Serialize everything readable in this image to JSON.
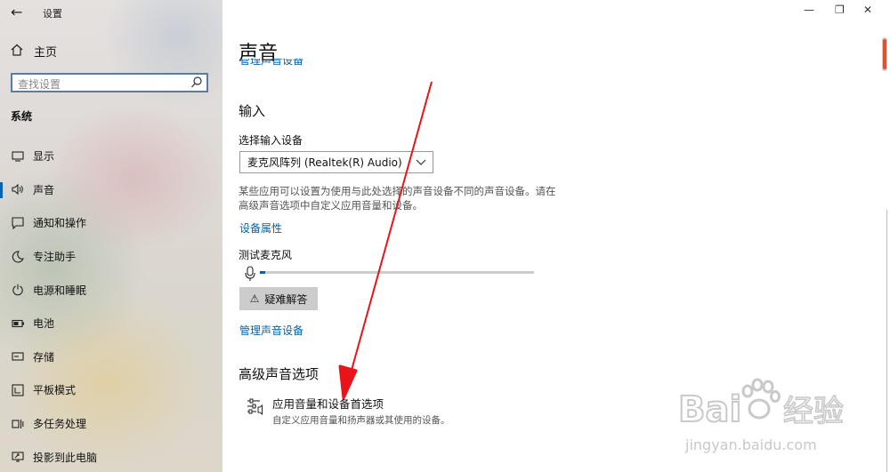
{
  "window": {
    "title": "设置",
    "controls": {
      "minimize": "—",
      "maximize": "❐",
      "close": "✕"
    }
  },
  "sidebar": {
    "back_icon": "back-arrow-icon",
    "home_label": "主页",
    "search_placeholder": "查找设置",
    "section_title": "系统",
    "items": [
      {
        "label": "显示",
        "icon": "display-icon",
        "active": false
      },
      {
        "label": "声音",
        "icon": "speaker-icon",
        "active": true
      },
      {
        "label": "通知和操作",
        "icon": "notification-icon",
        "active": false
      },
      {
        "label": "专注助手",
        "icon": "moon-icon",
        "active": false
      },
      {
        "label": "电源和睡眠",
        "icon": "power-icon",
        "active": false
      },
      {
        "label": "电池",
        "icon": "battery-icon",
        "active": false
      },
      {
        "label": "存储",
        "icon": "storage-icon",
        "active": false
      },
      {
        "label": "平板模式",
        "icon": "tablet-icon",
        "active": false
      },
      {
        "label": "多任务处理",
        "icon": "multitask-icon",
        "active": false
      },
      {
        "label": "投影到此电脑",
        "icon": "project-icon",
        "active": false
      }
    ]
  },
  "main": {
    "title": "声音",
    "clipped_link": "管理声音设备",
    "input_heading": "输入",
    "select_label": "选择输入设备",
    "selected_device": "麦克风阵列 (Realtek(R) Audio)",
    "description": "某些应用可以设置为使用与此处选择的声音设备不同的声音设备。请在高级声音选项中自定义应用音量和设备。",
    "device_properties_link": "设备属性",
    "test_mic_label": "测试麦克风",
    "mic_level": 0.02,
    "troubleshoot_label": "疑难解答",
    "manage_devices_link": "管理声音设备",
    "advanced_heading": "高级声音选项",
    "advanced_item_title": "应用音量和设备首选项",
    "advanced_item_desc": "自定义应用音量和扬声器或其使用的设备。"
  },
  "watermark": {
    "brand": "Bai",
    "brand_cn": "经验",
    "url": "jingyan.baidu.com"
  },
  "colors": {
    "accent": "#0063b1",
    "arrow": "#e8141a",
    "watermark": "#c9c9c9"
  }
}
